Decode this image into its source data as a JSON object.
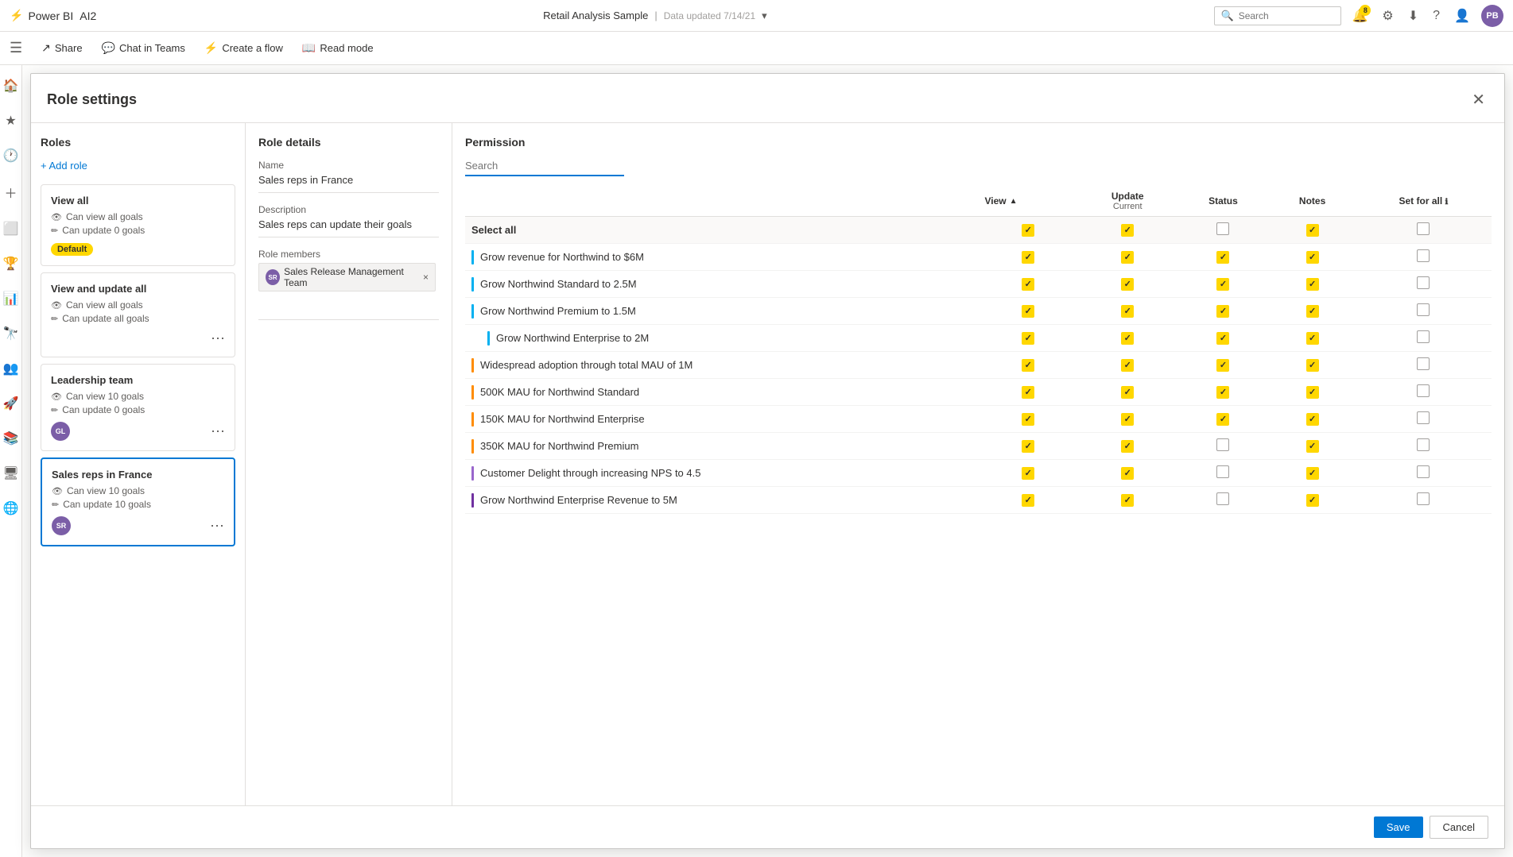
{
  "topbar": {
    "logo_text": "Power BI",
    "app_name": "AI2",
    "title": "Retail Analysis Sample",
    "separator": "|",
    "updated_text": "Data updated 7/14/21",
    "chevron": "▾",
    "search_placeholder": "Search",
    "notif_count": "8",
    "avatar_initials": "PB"
  },
  "secondbar": {
    "share_label": "Share",
    "chat_label": "Chat in Teams",
    "flow_label": "Create a flow",
    "read_label": "Read mode"
  },
  "modal": {
    "title": "Role settings",
    "close_icon": "✕"
  },
  "roles_panel": {
    "title": "Roles",
    "add_role_label": "+ Add role",
    "roles": [
      {
        "name": "View all",
        "can_view": "Can view all goals",
        "can_update": "Can update 0 goals",
        "default": true,
        "selected": false
      },
      {
        "name": "View and update all",
        "can_view": "Can view all goals",
        "can_update": "Can update all goals",
        "default": false,
        "selected": false,
        "has_more": true
      },
      {
        "name": "Leadership team",
        "can_view": "Can view 10 goals",
        "can_update": "Can update 0 goals",
        "default": false,
        "selected": false,
        "avatar": "GL",
        "has_more": true
      },
      {
        "name": "Sales reps in France",
        "can_view": "Can view 10 goals",
        "can_update": "Can update 10 goals",
        "default": false,
        "selected": true,
        "avatar": "SR",
        "has_more": true
      }
    ]
  },
  "role_details": {
    "title": "Role details",
    "name_label": "Name",
    "name_value": "Sales reps in France",
    "description_label": "Description",
    "description_value": "Sales reps can update their goals",
    "members_label": "Role members",
    "member_avatar": "SR",
    "member_name": "Sales Release Management Team",
    "member_remove": "×"
  },
  "permission": {
    "title": "Permission",
    "search_placeholder": "Search",
    "view_label": "View",
    "update_label": "Update",
    "current_label": "Current",
    "status_label": "Status",
    "notes_label": "Notes",
    "set_for_all_label": "Set for all",
    "select_all_label": "Select all",
    "goals": [
      {
        "name": "Grow revenue for Northwind to $6M",
        "color": "#00b0f0",
        "indent": 0,
        "view": true,
        "update": true,
        "current": true,
        "status": true,
        "notes": false
      },
      {
        "name": "Grow Northwind Standard to 2.5M",
        "color": "#00b0f0",
        "indent": 0,
        "view": true,
        "update": true,
        "current": true,
        "status": true,
        "notes": false
      },
      {
        "name": "Grow Northwind Premium to 1.5M",
        "color": "#00b0f0",
        "indent": 0,
        "view": true,
        "update": true,
        "current": true,
        "status": true,
        "notes": false
      },
      {
        "name": "Grow Northwind Enterprise to 2M",
        "color": "#00b0f0",
        "indent": 1,
        "view": true,
        "update": true,
        "current": true,
        "status": true,
        "notes": false
      },
      {
        "name": "Widespread adoption through total MAU of 1M",
        "color": "#ff8c00",
        "indent": 0,
        "view": true,
        "update": true,
        "current": true,
        "status": true,
        "notes": false
      },
      {
        "name": "500K MAU for Northwind Standard",
        "color": "#ff8c00",
        "indent": 0,
        "view": true,
        "update": true,
        "current": true,
        "status": true,
        "notes": false
      },
      {
        "name": "150K MAU for Northwind Enterprise",
        "color": "#ff8c00",
        "indent": 0,
        "view": true,
        "update": true,
        "current": true,
        "status": true,
        "notes": false
      },
      {
        "name": "350K MAU for Northwind Premium",
        "color": "#ff8c00",
        "indent": 0,
        "view": true,
        "update": true,
        "current": false,
        "status": true,
        "notes": false
      },
      {
        "name": "Customer Delight through increasing NPS to 4.5",
        "color": "#9966cc",
        "indent": 0,
        "view": true,
        "update": true,
        "current": false,
        "status": true,
        "notes": false
      },
      {
        "name": "Grow Northwind Enterprise Revenue to 5M",
        "color": "#7030a0",
        "indent": 0,
        "view": true,
        "update": true,
        "current": false,
        "status": true,
        "notes": false
      }
    ]
  },
  "footer": {
    "save_label": "Save",
    "cancel_label": "Cancel"
  }
}
